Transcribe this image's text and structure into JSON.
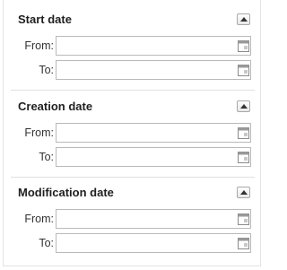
{
  "sections": [
    {
      "title": "Start date",
      "from_label": "From:",
      "from_value": "",
      "to_label": "To:",
      "to_value": ""
    },
    {
      "title": "Creation date",
      "from_label": "From:",
      "from_value": "",
      "to_label": "To:",
      "to_value": ""
    },
    {
      "title": "Modification date",
      "from_label": "From:",
      "from_value": "",
      "to_label": "To:",
      "to_value": ""
    }
  ],
  "icons": {
    "collapse": "collapse-up-arrow-icon",
    "calendar": "calendar-icon"
  }
}
